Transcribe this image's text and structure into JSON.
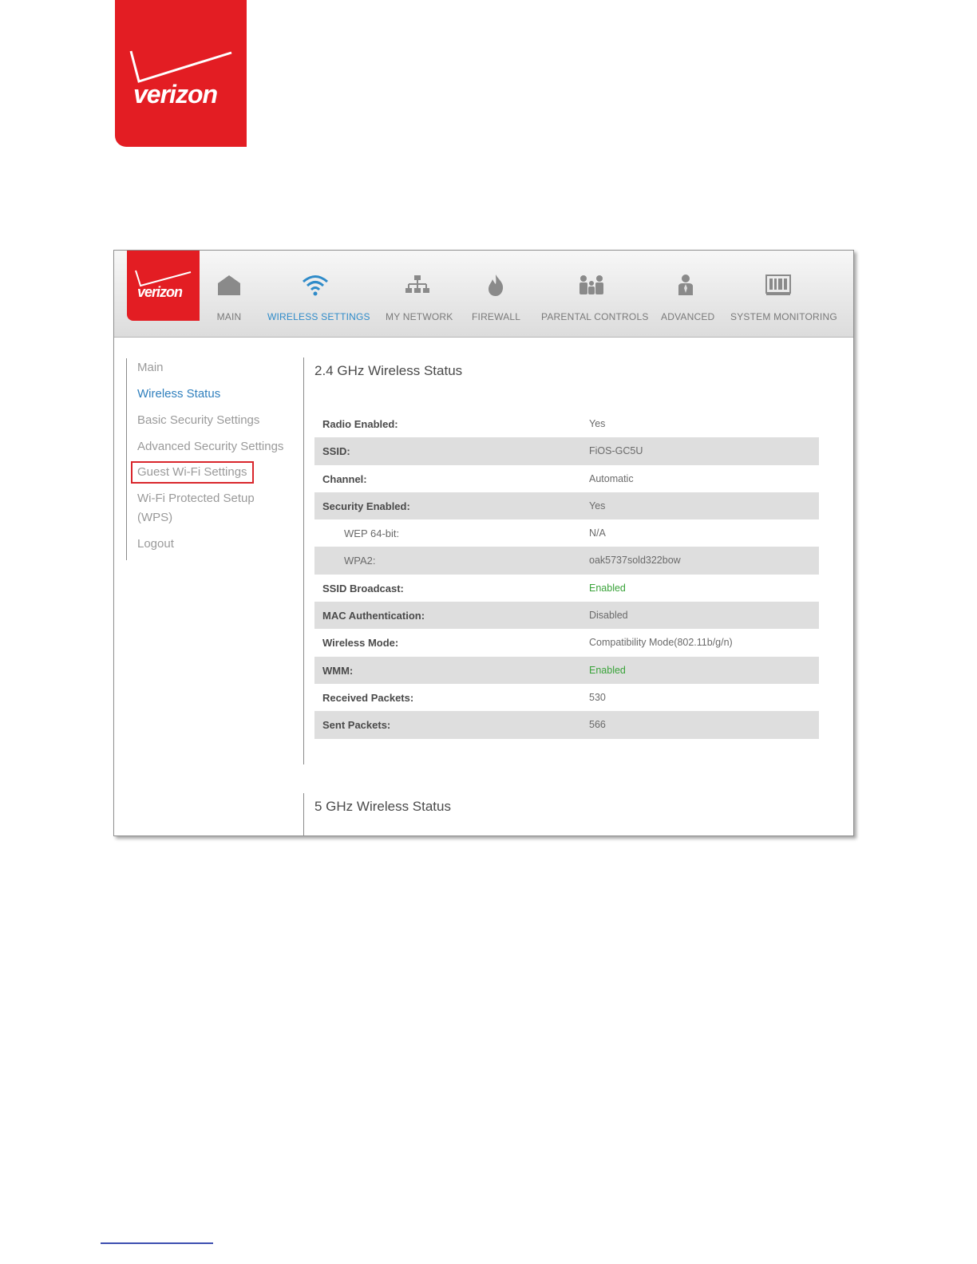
{
  "brand": {
    "name": "verizon",
    "color": "#e31d23"
  },
  "nav": {
    "items": [
      {
        "label": "MAIN",
        "icon": "house-icon"
      },
      {
        "label": "WIRELESS SETTINGS",
        "icon": "wifi-icon",
        "active": true
      },
      {
        "label": "MY NETWORK",
        "icon": "network-icon"
      },
      {
        "label": "FIREWALL",
        "icon": "flame-icon"
      },
      {
        "label": "PARENTAL CONTROLS",
        "icon": "family-icon"
      },
      {
        "label": "ADVANCED",
        "icon": "user-icon"
      },
      {
        "label": "SYSTEM MONITORING",
        "icon": "monitor-icon"
      }
    ],
    "active_color": "#2f8bc9"
  },
  "sidebar": {
    "items": [
      {
        "label": "Main"
      },
      {
        "label": "Wireless Status",
        "active": true
      },
      {
        "label": "Basic Security Settings"
      },
      {
        "label": "Advanced Security Settings"
      },
      {
        "label": "Guest Wi-Fi Settings",
        "highlighted": true
      },
      {
        "label": "Wi-Fi Protected Setup (WPS)"
      },
      {
        "label": "Logout"
      }
    ]
  },
  "sections": {
    "ghz24_title": "2.4 GHz Wireless Status",
    "ghz5_title": "5 GHz Wireless Status"
  },
  "status_rows": [
    {
      "label": "Radio Enabled:",
      "value": "Yes"
    },
    {
      "label": "SSID:",
      "value": "FiOS-GC5U"
    },
    {
      "label": "Channel:",
      "value": "Automatic"
    },
    {
      "label": "Security Enabled:",
      "value": "Yes"
    },
    {
      "label": "WEP 64-bit:",
      "value": "N/A"
    },
    {
      "label": "WPA2:",
      "value": "oak5737sold322bow"
    },
    {
      "label": "SSID Broadcast:",
      "value": "Enabled"
    },
    {
      "label": "MAC Authentication:",
      "value": "Disabled"
    },
    {
      "label": "Wireless Mode:",
      "value": "Compatibility Mode(802.11b/g/n)"
    },
    {
      "label": "WMM:",
      "value": "Enabled"
    },
    {
      "label": "Received Packets:",
      "value": "530"
    },
    {
      "label": "Sent Packets:",
      "value": "566"
    }
  ],
  "colors": {
    "enabled_value": "#3aa33a",
    "highlight_box": "#d9262c"
  }
}
